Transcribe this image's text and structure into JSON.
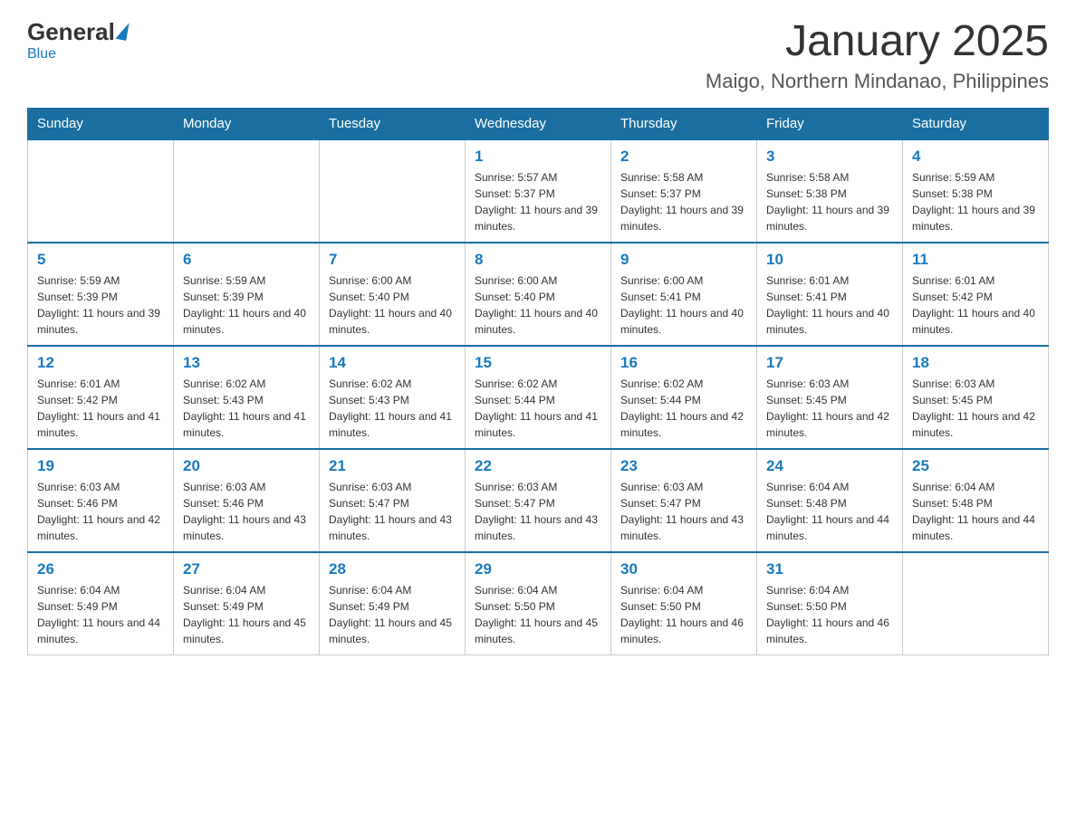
{
  "header": {
    "logo_general": "General",
    "logo_blue": "Blue",
    "month_title": "January 2025",
    "location": "Maigo, Northern Mindanao, Philippines"
  },
  "weekdays": [
    "Sunday",
    "Monday",
    "Tuesday",
    "Wednesday",
    "Thursday",
    "Friday",
    "Saturday"
  ],
  "weeks": [
    [
      {
        "day": "",
        "info": ""
      },
      {
        "day": "",
        "info": ""
      },
      {
        "day": "",
        "info": ""
      },
      {
        "day": "1",
        "info": "Sunrise: 5:57 AM\nSunset: 5:37 PM\nDaylight: 11 hours and 39 minutes."
      },
      {
        "day": "2",
        "info": "Sunrise: 5:58 AM\nSunset: 5:37 PM\nDaylight: 11 hours and 39 minutes."
      },
      {
        "day": "3",
        "info": "Sunrise: 5:58 AM\nSunset: 5:38 PM\nDaylight: 11 hours and 39 minutes."
      },
      {
        "day": "4",
        "info": "Sunrise: 5:59 AM\nSunset: 5:38 PM\nDaylight: 11 hours and 39 minutes."
      }
    ],
    [
      {
        "day": "5",
        "info": "Sunrise: 5:59 AM\nSunset: 5:39 PM\nDaylight: 11 hours and 39 minutes."
      },
      {
        "day": "6",
        "info": "Sunrise: 5:59 AM\nSunset: 5:39 PM\nDaylight: 11 hours and 40 minutes."
      },
      {
        "day": "7",
        "info": "Sunrise: 6:00 AM\nSunset: 5:40 PM\nDaylight: 11 hours and 40 minutes."
      },
      {
        "day": "8",
        "info": "Sunrise: 6:00 AM\nSunset: 5:40 PM\nDaylight: 11 hours and 40 minutes."
      },
      {
        "day": "9",
        "info": "Sunrise: 6:00 AM\nSunset: 5:41 PM\nDaylight: 11 hours and 40 minutes."
      },
      {
        "day": "10",
        "info": "Sunrise: 6:01 AM\nSunset: 5:41 PM\nDaylight: 11 hours and 40 minutes."
      },
      {
        "day": "11",
        "info": "Sunrise: 6:01 AM\nSunset: 5:42 PM\nDaylight: 11 hours and 40 minutes."
      }
    ],
    [
      {
        "day": "12",
        "info": "Sunrise: 6:01 AM\nSunset: 5:42 PM\nDaylight: 11 hours and 41 minutes."
      },
      {
        "day": "13",
        "info": "Sunrise: 6:02 AM\nSunset: 5:43 PM\nDaylight: 11 hours and 41 minutes."
      },
      {
        "day": "14",
        "info": "Sunrise: 6:02 AM\nSunset: 5:43 PM\nDaylight: 11 hours and 41 minutes."
      },
      {
        "day": "15",
        "info": "Sunrise: 6:02 AM\nSunset: 5:44 PM\nDaylight: 11 hours and 41 minutes."
      },
      {
        "day": "16",
        "info": "Sunrise: 6:02 AM\nSunset: 5:44 PM\nDaylight: 11 hours and 42 minutes."
      },
      {
        "day": "17",
        "info": "Sunrise: 6:03 AM\nSunset: 5:45 PM\nDaylight: 11 hours and 42 minutes."
      },
      {
        "day": "18",
        "info": "Sunrise: 6:03 AM\nSunset: 5:45 PM\nDaylight: 11 hours and 42 minutes."
      }
    ],
    [
      {
        "day": "19",
        "info": "Sunrise: 6:03 AM\nSunset: 5:46 PM\nDaylight: 11 hours and 42 minutes."
      },
      {
        "day": "20",
        "info": "Sunrise: 6:03 AM\nSunset: 5:46 PM\nDaylight: 11 hours and 43 minutes."
      },
      {
        "day": "21",
        "info": "Sunrise: 6:03 AM\nSunset: 5:47 PM\nDaylight: 11 hours and 43 minutes."
      },
      {
        "day": "22",
        "info": "Sunrise: 6:03 AM\nSunset: 5:47 PM\nDaylight: 11 hours and 43 minutes."
      },
      {
        "day": "23",
        "info": "Sunrise: 6:03 AM\nSunset: 5:47 PM\nDaylight: 11 hours and 43 minutes."
      },
      {
        "day": "24",
        "info": "Sunrise: 6:04 AM\nSunset: 5:48 PM\nDaylight: 11 hours and 44 minutes."
      },
      {
        "day": "25",
        "info": "Sunrise: 6:04 AM\nSunset: 5:48 PM\nDaylight: 11 hours and 44 minutes."
      }
    ],
    [
      {
        "day": "26",
        "info": "Sunrise: 6:04 AM\nSunset: 5:49 PM\nDaylight: 11 hours and 44 minutes."
      },
      {
        "day": "27",
        "info": "Sunrise: 6:04 AM\nSunset: 5:49 PM\nDaylight: 11 hours and 45 minutes."
      },
      {
        "day": "28",
        "info": "Sunrise: 6:04 AM\nSunset: 5:49 PM\nDaylight: 11 hours and 45 minutes."
      },
      {
        "day": "29",
        "info": "Sunrise: 6:04 AM\nSunset: 5:50 PM\nDaylight: 11 hours and 45 minutes."
      },
      {
        "day": "30",
        "info": "Sunrise: 6:04 AM\nSunset: 5:50 PM\nDaylight: 11 hours and 46 minutes."
      },
      {
        "day": "31",
        "info": "Sunrise: 6:04 AM\nSunset: 5:50 PM\nDaylight: 11 hours and 46 minutes."
      },
      {
        "day": "",
        "info": ""
      }
    ]
  ]
}
